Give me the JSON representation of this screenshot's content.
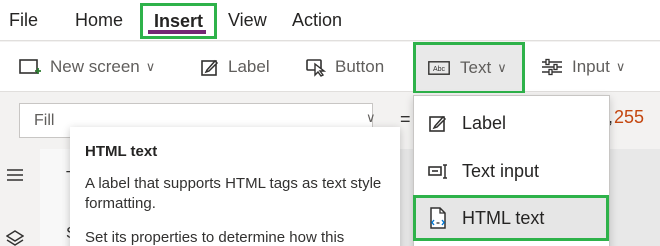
{
  "menu": {
    "tabs": [
      "File",
      "Home",
      "Insert",
      "View",
      "Action"
    ],
    "active_tab": "Insert"
  },
  "ribbon": {
    "new_screen": "New screen",
    "label": "Label",
    "button": "Button",
    "text": "Text",
    "input": "Input",
    "chevron": "∨"
  },
  "formula_bar": {
    "property": "Fill",
    "equals": "=",
    "value_comma": ",",
    "value": "255"
  },
  "tree": {
    "item1": "T",
    "item2": "S"
  },
  "tooltip": {
    "title": "HTML text",
    "description": "A label that supports HTML tags as text style formatting.",
    "description2": "Set its properties to determine how this"
  },
  "text_dropdown": {
    "items": [
      "Label",
      "Text input",
      "HTML text"
    ],
    "highlighted": "HTML text"
  },
  "colors": {
    "highlight_border": "#2eb24a",
    "active_tab_underline": "#742774",
    "formula_value": "#c4460f"
  },
  "icons": [
    "new-screen-icon",
    "label-pencil-icon",
    "button-cursor-icon",
    "text-abc-icon",
    "input-sliders-icon",
    "hamburger-icon",
    "layers-icon",
    "label-icon",
    "text-input-icon",
    "html-text-icon"
  ]
}
